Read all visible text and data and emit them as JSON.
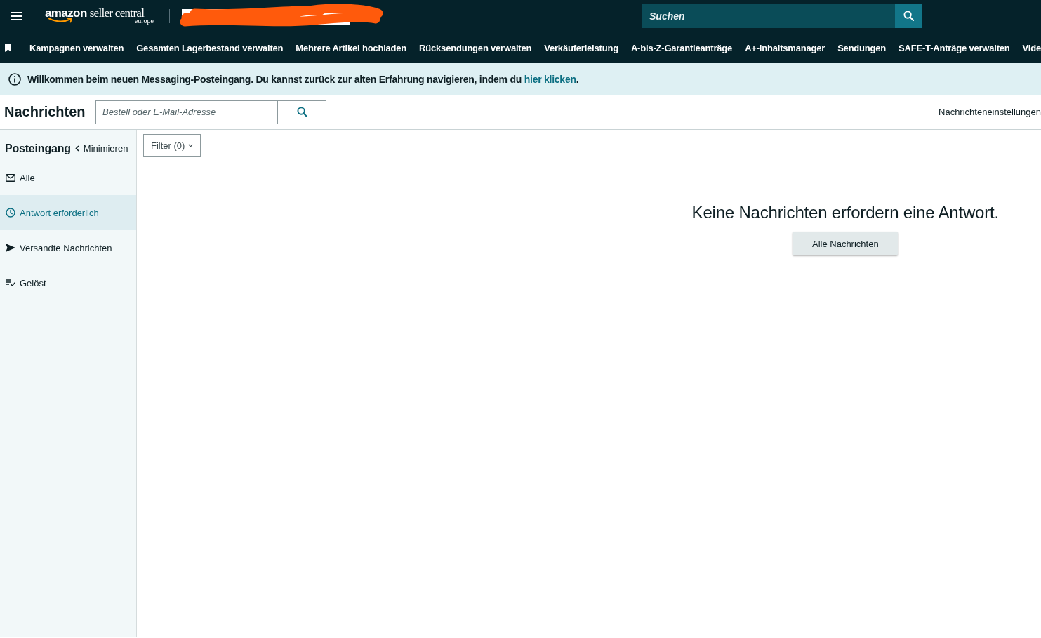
{
  "top_bar": {
    "logo": {
      "brand": "amazon",
      "product": "seller central",
      "region": "europe"
    },
    "search": {
      "placeholder": "Suchen"
    }
  },
  "nav": {
    "items": [
      "Kampagnen verwalten",
      "Gesamten Lagerbestand verwalten",
      "Mehrere Artikel hochladen",
      "Rücksendungen verwalten",
      "Verkäuferleistung",
      "A-bis-Z-Garantieanträge",
      "A+-Inhaltsmanager",
      "Sendungen",
      "SAFE-T-Anträge verwalten",
      "Vide"
    ]
  },
  "banner": {
    "text": "Willkommen beim neuen Messaging-Posteingang. Du kannst zurück zur alten Erfahrung navigieren, indem du",
    "link": "hier klicken",
    "after": "."
  },
  "header": {
    "title": "Nachrichten",
    "search": {
      "placeholder": "Bestell oder E-Mail-Adresse"
    },
    "settings_link": "Nachrichteneinstellungen"
  },
  "sidebar": {
    "title": "Posteingang",
    "collapse": "Minimieren",
    "items": [
      {
        "label": "Alle",
        "selected": false
      },
      {
        "label": "Antwort erforderlich",
        "selected": true
      },
      {
        "label": "Versandte Nachrichten",
        "selected": false
      },
      {
        "label": "Gelöst",
        "selected": false
      }
    ]
  },
  "filter": {
    "label": "Filter (0)"
  },
  "empty_state": {
    "message": "Keine Nachrichten erfordern eine Antwort.",
    "button": "Alle Nachrichten"
  }
}
